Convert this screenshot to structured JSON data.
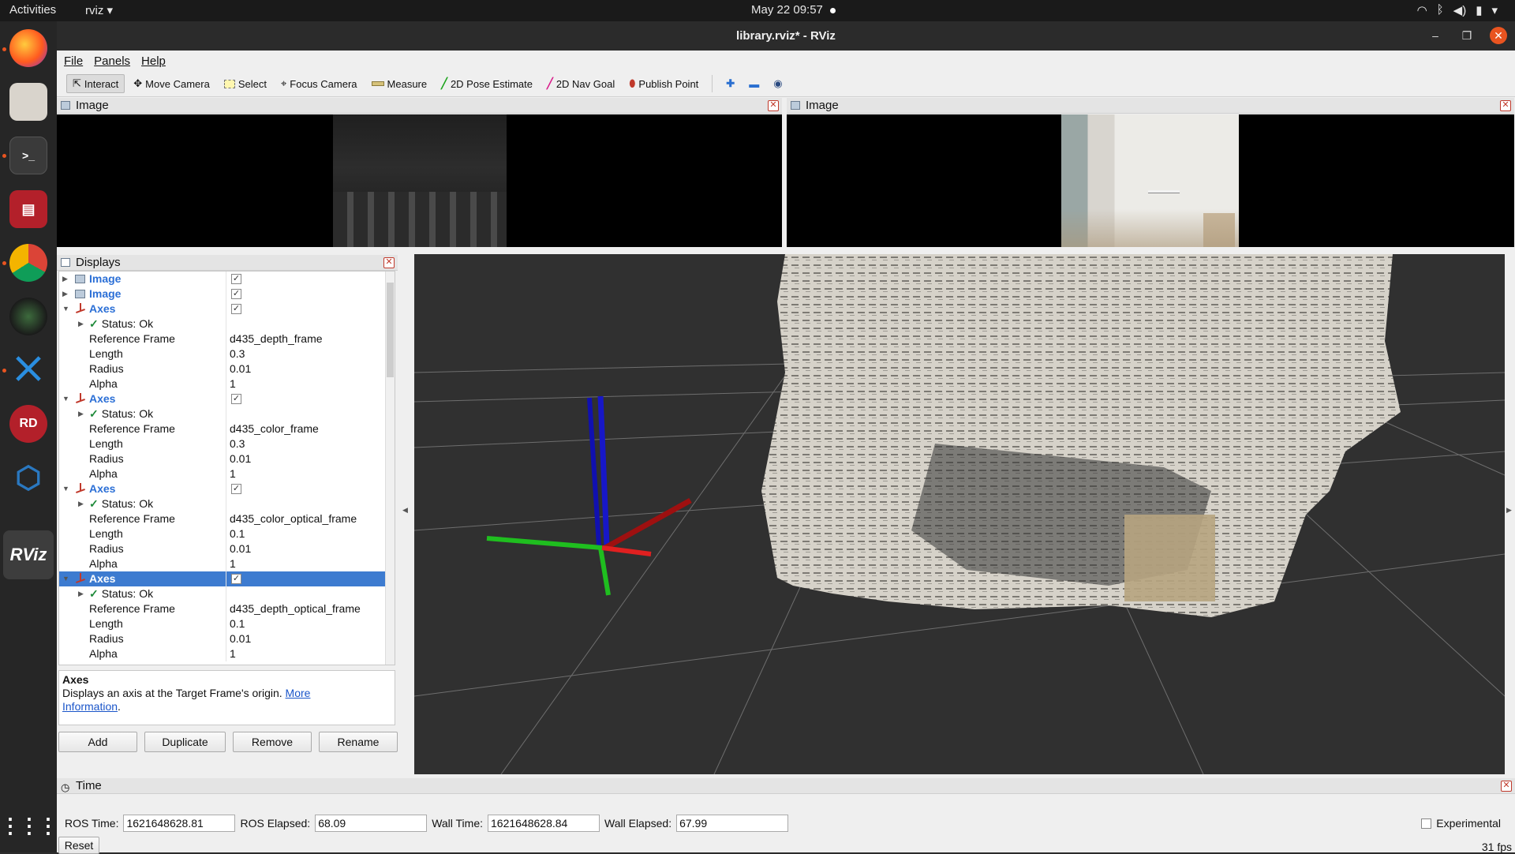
{
  "topbar": {
    "activities": "Activities",
    "app_menu": "rviz ▾",
    "datetime": "May 22  09:57",
    "tray_icons": [
      "wifi-icon",
      "bluetooth-icon",
      "volume-icon",
      "battery-icon",
      "system-menu-icon"
    ]
  },
  "dock": {
    "apps": [
      "firefox-icon",
      "files-icon",
      "terminal-icon",
      "media-app-icon",
      "chrome-icon",
      "camera-app-icon",
      "vscode-icon",
      "rdc-icon",
      "virtualbox-icon",
      "rviz-icon"
    ],
    "rviz_label": "RViz"
  },
  "window": {
    "title": "library.rviz* - RViz",
    "minimize": "–",
    "maximize": "❐",
    "close": "✕"
  },
  "menu": {
    "file": "File",
    "panels": "Panels",
    "help": "Help"
  },
  "toolbar": {
    "interact": "Interact",
    "move_camera": "Move Camera",
    "select": "Select",
    "focus_camera": "Focus Camera",
    "measure": "Measure",
    "pose_estimate": "2D Pose Estimate",
    "nav_goal": "2D Nav Goal",
    "publish_point": "Publish Point"
  },
  "image_panels": {
    "left_title": "Image",
    "right_title": "Image"
  },
  "displays": {
    "title": "Displays",
    "rows": [
      {
        "label": "Image"
      },
      {
        "label": "Image"
      },
      {
        "label": "Axes"
      },
      {
        "label": "Status: Ok"
      },
      {
        "label": "Reference Frame",
        "value": "d435_depth_frame"
      },
      {
        "label": "Length",
        "value": "0.3"
      },
      {
        "label": "Radius",
        "value": "0.01"
      },
      {
        "label": "Alpha",
        "value": "1"
      },
      {
        "label": "Axes"
      },
      {
        "label": "Status: Ok"
      },
      {
        "label": "Reference Frame",
        "value": "d435_color_frame"
      },
      {
        "label": "Length",
        "value": "0.3"
      },
      {
        "label": "Radius",
        "value": "0.01"
      },
      {
        "label": "Alpha",
        "value": "1"
      },
      {
        "label": "Axes"
      },
      {
        "label": "Status: Ok"
      },
      {
        "label": "Reference Frame",
        "value": "d435_color_optical_frame"
      },
      {
        "label": "Length",
        "value": "0.1"
      },
      {
        "label": "Radius",
        "value": "0.01"
      },
      {
        "label": "Alpha",
        "value": "1"
      },
      {
        "label": "Axes"
      },
      {
        "label": "Status: Ok"
      },
      {
        "label": "Reference Frame",
        "value": "d435_depth_optical_frame"
      },
      {
        "label": "Length",
        "value": "0.1"
      },
      {
        "label": "Radius",
        "value": "0.01"
      },
      {
        "label": "Alpha",
        "value": "1"
      }
    ],
    "description_title": "Axes",
    "description_text": "Displays an axis at the Target Frame's origin.",
    "description_link_1": "More",
    "description_link_2": "Information",
    "description_tail": ".",
    "buttons": {
      "add": "Add",
      "duplicate": "Duplicate",
      "remove": "Remove",
      "rename": "Rename"
    }
  },
  "time": {
    "title": "Time",
    "ros_time_label": "ROS Time:",
    "ros_time": "1621648628.81",
    "ros_elapsed_label": "ROS Elapsed:",
    "ros_elapsed": "68.09",
    "wall_time_label": "Wall Time:",
    "wall_time": "1621648628.84",
    "wall_elapsed_label": "Wall Elapsed:",
    "wall_elapsed": "67.99",
    "experimental": "Experimental",
    "reset": "Reset",
    "fps": "31 fps"
  }
}
